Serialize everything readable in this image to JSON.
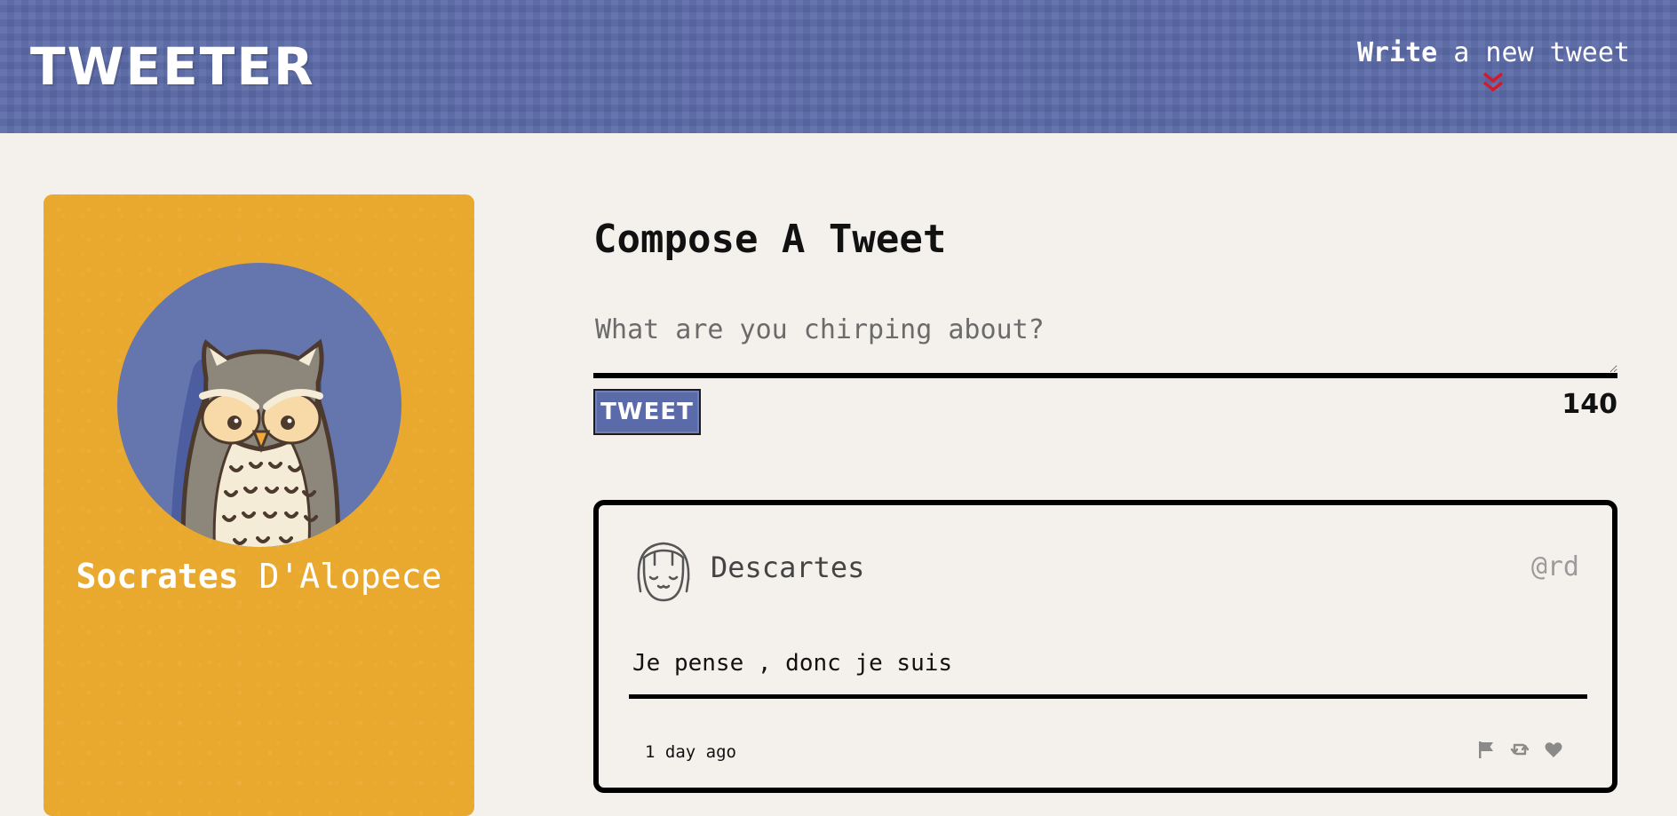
{
  "colors": {
    "header_bg": "#5b6aa8",
    "page_bg": "#f4f1ec",
    "profile_bg": "#e9a92e",
    "nav_arrow": "#d41a2a",
    "action_icon": "#8a8a8a"
  },
  "header": {
    "logo": "TWEETER",
    "compose_link_bold": "Write",
    "compose_link_rest": " a new tweet",
    "compose_link_icon": "double-chevron-down-icon"
  },
  "profile": {
    "first_name": "Socrates",
    "last_name": " D'Alopece",
    "avatar_icon": "owl-avatar"
  },
  "compose": {
    "title": "Compose A Tweet",
    "placeholder": "What are you chirping about?",
    "value": "",
    "button_label": "TWEET",
    "counter": "140"
  },
  "tweets": [
    {
      "name": "Descartes",
      "handle": "@rd",
      "text": "Je pense , donc je suis",
      "time": "1 day ago",
      "avatar_icon": "girl-face-avatar",
      "actions": [
        "flag-icon",
        "retweet-icon",
        "heart-icon"
      ]
    }
  ]
}
